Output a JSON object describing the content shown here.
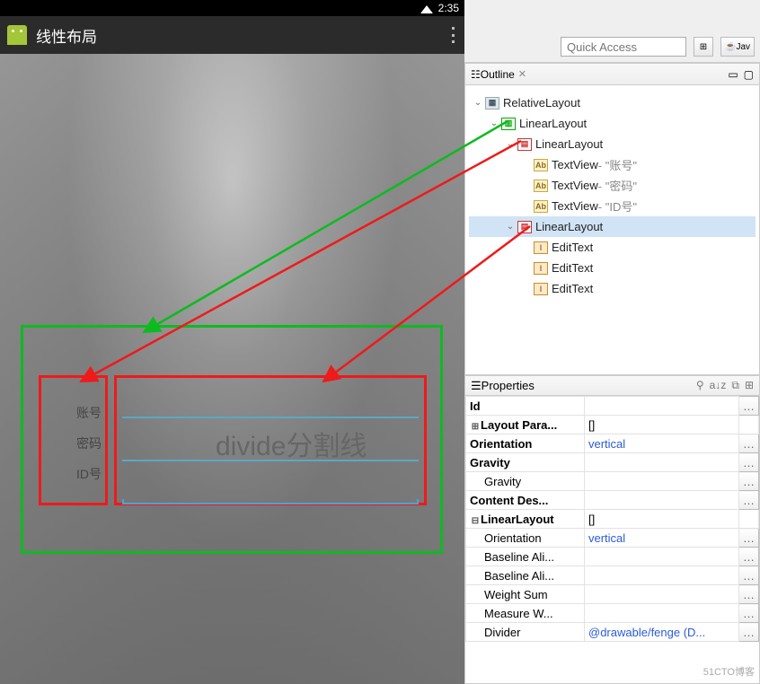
{
  "statusbar": {
    "time": "2:35"
  },
  "appbar": {
    "title": "线性布局"
  },
  "form": {
    "labels": [
      "账号",
      "密码",
      "ID号"
    ],
    "divider_hint": "divide分割线"
  },
  "toolbar": {
    "quick_access_placeholder": "Quick Access",
    "perspective_java": "Jav"
  },
  "outline": {
    "tab_label": "Outline",
    "tree": [
      {
        "depth": 0,
        "twisty": "v",
        "icon": "rel",
        "name": "RelativeLayout"
      },
      {
        "depth": 1,
        "twisty": "v",
        "icon": "lin-outer",
        "name": "LinearLayout"
      },
      {
        "depth": 2,
        "twisty": "v",
        "icon": "lin",
        "name": "LinearLayout"
      },
      {
        "depth": 3,
        "twisty": "",
        "icon": "text",
        "name": "TextView",
        "extra": " - \"账号\""
      },
      {
        "depth": 3,
        "twisty": "",
        "icon": "text",
        "name": "TextView",
        "extra": " - \"密码\""
      },
      {
        "depth": 3,
        "twisty": "",
        "icon": "text",
        "name": "TextView",
        "extra": " - \"ID号\""
      },
      {
        "depth": 2,
        "twisty": "v",
        "icon": "lin",
        "name": "LinearLayout",
        "selected": true
      },
      {
        "depth": 3,
        "twisty": "",
        "icon": "edit",
        "name": "EditText"
      },
      {
        "depth": 3,
        "twisty": "",
        "icon": "edit",
        "name": "EditText"
      },
      {
        "depth": 3,
        "twisty": "",
        "icon": "edit",
        "name": "EditText"
      }
    ]
  },
  "properties": {
    "header": "Properties",
    "rows": [
      {
        "name": "Id",
        "value": "",
        "bold": true,
        "btn": true
      },
      {
        "name": "Layout Para...",
        "value": "[]",
        "bold": true,
        "exp": "+"
      },
      {
        "name": "Orientation",
        "value": "vertical",
        "bold": true,
        "blue": true,
        "btn": true
      },
      {
        "name": "Gravity",
        "value": "",
        "bold": true,
        "btn": true
      },
      {
        "name": "Gravity",
        "value": "",
        "bold": false,
        "sub": true,
        "btn": true
      },
      {
        "name": "Content Des...",
        "value": "",
        "bold": true,
        "btn": true
      },
      {
        "name": "LinearLayout",
        "value": "[]",
        "bold": true,
        "exp": "-"
      },
      {
        "name": "Orientation",
        "value": "vertical",
        "bold": false,
        "sub": true,
        "blue": true,
        "btn": true
      },
      {
        "name": "Baseline Ali...",
        "value": "",
        "sub": true,
        "btn": true
      },
      {
        "name": "Baseline Ali...",
        "value": "",
        "sub": true,
        "btn": true
      },
      {
        "name": "Weight Sum",
        "value": "",
        "sub": true,
        "btn": true
      },
      {
        "name": "Measure W...",
        "value": "",
        "sub": true,
        "btn": true
      },
      {
        "name": "Divider",
        "value": "@drawable/fenge (D...",
        "sub": true,
        "blue": true,
        "btn": true
      }
    ]
  },
  "watermark": "51CTO博客"
}
